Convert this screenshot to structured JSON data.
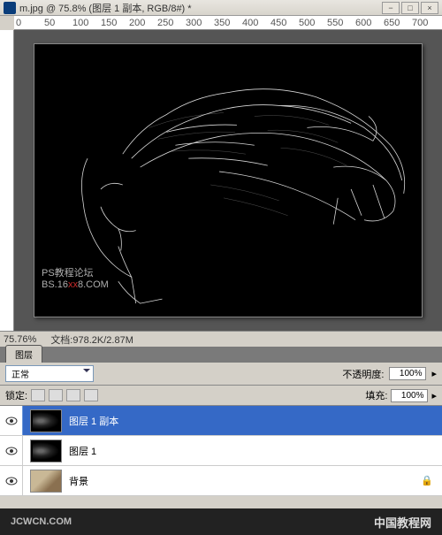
{
  "title": "m.jpg @ 75.8% (图层 1 副本, RGB/8#) *",
  "win": {
    "min": "−",
    "max": "□",
    "close": "×"
  },
  "ruler": {
    "marks": [
      "0",
      "50",
      "100",
      "150",
      "200",
      "250",
      "300",
      "350",
      "400",
      "450",
      "500",
      "550",
      "600",
      "650",
      "700"
    ]
  },
  "watermark": {
    "l1": "PS教程论坛",
    "l2a": "BS.16",
    "l2b": "xx",
    "l2c": "8.COM"
  },
  "status": {
    "zoom": "75.76%",
    "doc_label": "文档:",
    "doc": "978.2K/2.87M"
  },
  "layers_panel": {
    "tab": "图层",
    "blend_mode": "正常",
    "opacity_label": "不透明度:",
    "opacity": "100%",
    "lock_label": "锁定:",
    "fill_label": "填充:",
    "fill": "100%",
    "items": [
      {
        "name": "图层 1 副本",
        "visible": true,
        "selected": true,
        "thumb": "img"
      },
      {
        "name": "图层 1",
        "visible": true,
        "selected": false,
        "thumb": "img"
      },
      {
        "name": "背景",
        "visible": true,
        "selected": false,
        "thumb": "bg",
        "locked": true
      }
    ]
  },
  "footer": {
    "url": "JCWCN.COM",
    "brand": "中国教程网"
  }
}
